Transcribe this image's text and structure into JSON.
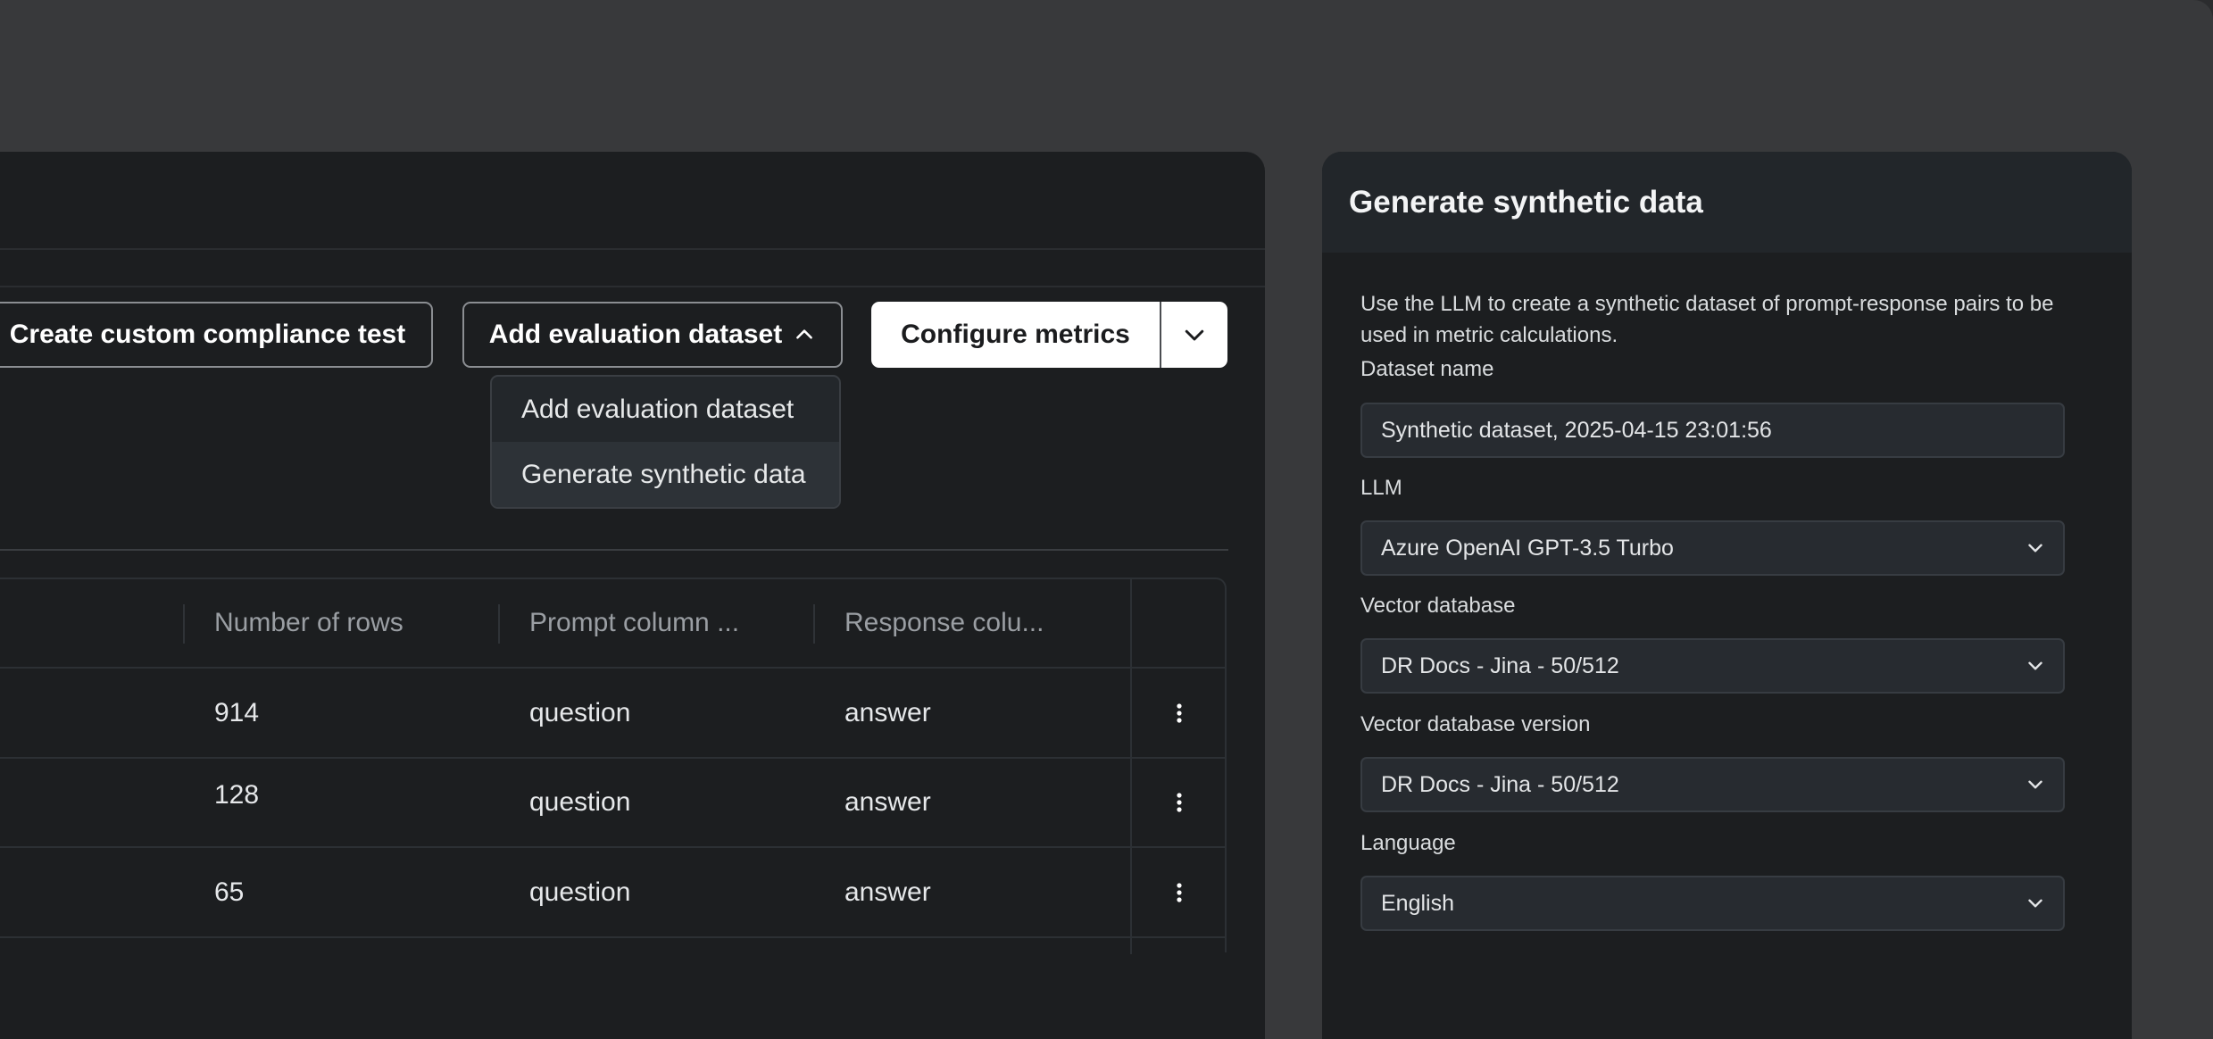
{
  "toolbar": {
    "create_custom_label": "Create custom compliance test",
    "add_dataset_label": "Add evaluation dataset",
    "configure_metrics_label": "Configure metrics"
  },
  "dropdown": {
    "items": [
      {
        "label": "Add evaluation dataset"
      },
      {
        "label": "Generate synthetic data"
      }
    ]
  },
  "table": {
    "columns": [
      "Number of rows",
      "Prompt column ...",
      "Response colu..."
    ],
    "rows": [
      {
        "rows": "914",
        "prompt": "question",
        "response": "answer"
      },
      {
        "rows": "128",
        "prompt": "question",
        "response": "answer"
      },
      {
        "rows": "65",
        "prompt": "question",
        "response": "answer"
      }
    ]
  },
  "panel": {
    "title": "Generate synthetic data",
    "description": "Use the LLM to create a synthetic dataset of prompt-response pairs to be used in metric calculations.",
    "dataset_name_label": "Dataset name",
    "dataset_name_value": "Synthetic dataset, 2025-04-15 23:01:56",
    "llm_label": "LLM",
    "llm_value": "Azure OpenAI GPT-3.5 Turbo",
    "vector_db_label": "Vector database",
    "vector_db_value": "DR Docs - Jina - 50/512",
    "vector_db_version_label": "Vector database version",
    "vector_db_version_value": "DR Docs - Jina - 50/512",
    "language_label": "Language",
    "language_value": "English"
  }
}
